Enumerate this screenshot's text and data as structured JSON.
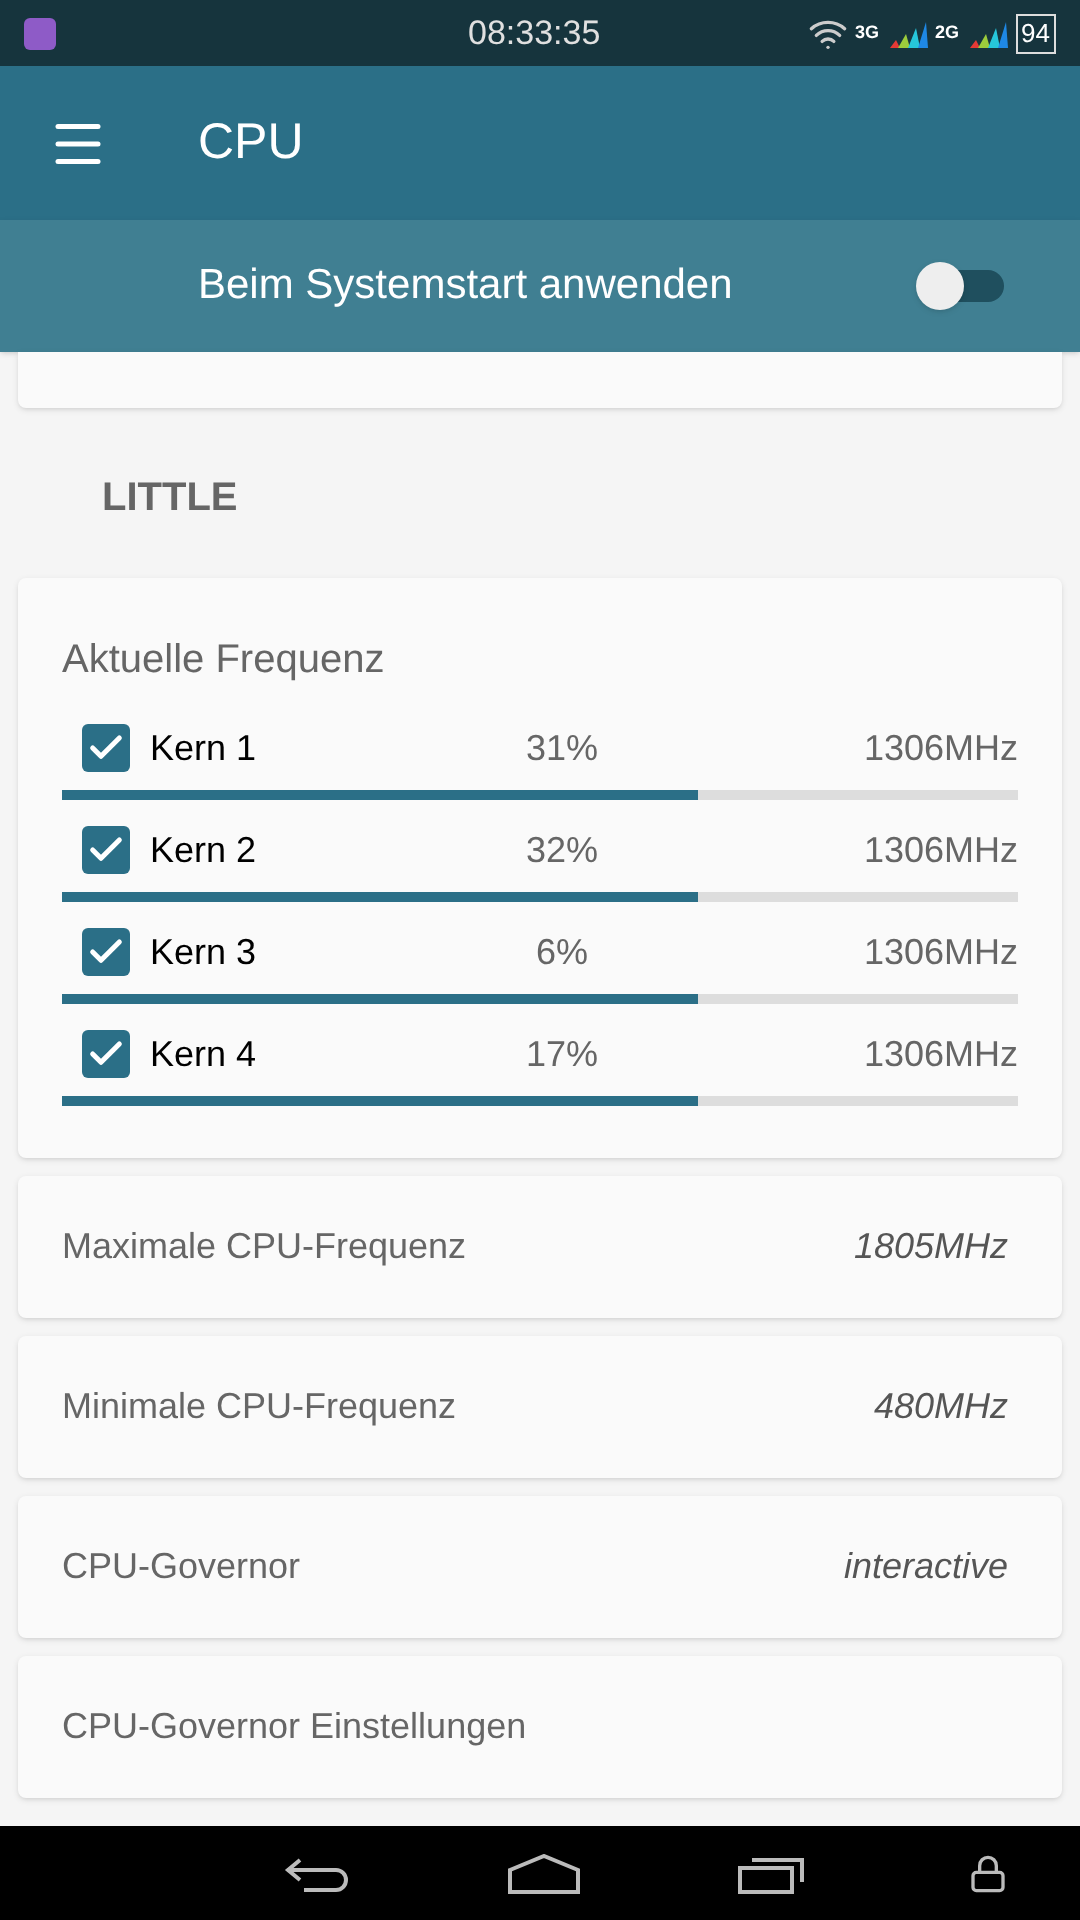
{
  "status_bar": {
    "time": "08:33:35",
    "network_1": "3G",
    "network_2": "2G",
    "battery": "94"
  },
  "app_bar": {
    "title": "CPU"
  },
  "boot_toggle": {
    "label": "Beim Systemstart anwenden",
    "on": false
  },
  "section": {
    "title": "LITTLE"
  },
  "current_frequency": {
    "title": "Aktuelle Frequenz",
    "cores": [
      {
        "name": "Kern 1",
        "checked": true,
        "usage": "31%",
        "frequency": "1306MHz",
        "level": 0.665
      },
      {
        "name": "Kern 2",
        "checked": true,
        "usage": "32%",
        "frequency": "1306MHz",
        "level": 0.665
      },
      {
        "name": "Kern 3",
        "checked": true,
        "usage": "6%",
        "frequency": "1306MHz",
        "level": 0.665
      },
      {
        "name": "Kern 4",
        "checked": true,
        "usage": "17%",
        "frequency": "1306MHz",
        "level": 0.665
      }
    ]
  },
  "settings": [
    {
      "label": "Maximale CPU-Frequenz",
      "value": "1805MHz"
    },
    {
      "label": "Minimale CPU-Frequenz",
      "value": "480MHz"
    },
    {
      "label": "CPU-Governor",
      "value": "interactive"
    },
    {
      "label": "CPU-Governor Einstellungen"
    }
  ]
}
